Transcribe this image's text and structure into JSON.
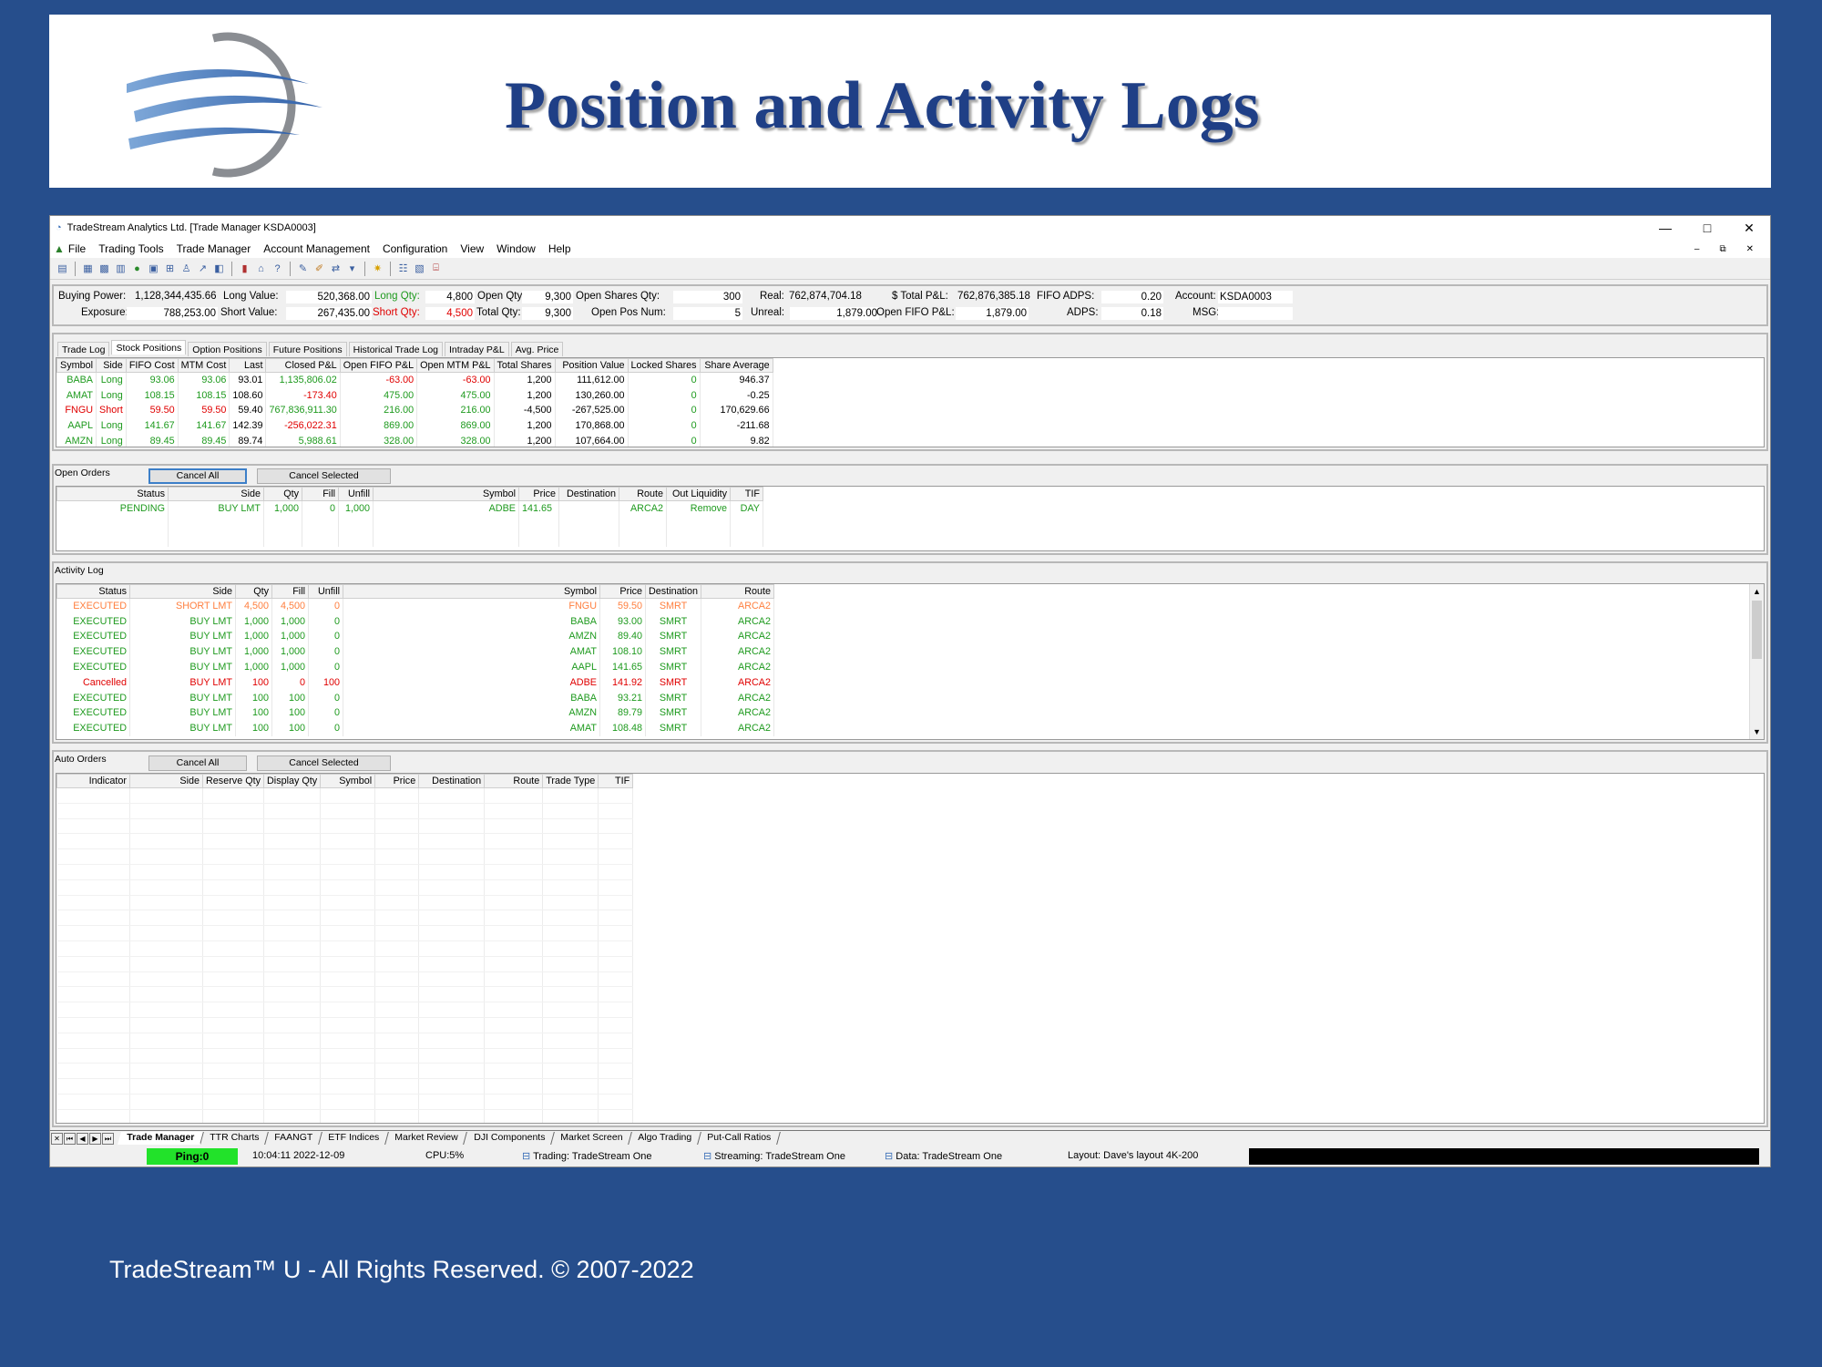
{
  "slide": {
    "title": "Position and Activity Logs",
    "footer": "TradeStream™ U - All Rights Reserved. © 2007-2022",
    "accent": "#1f3f86",
    "background": "#264e8c"
  },
  "window": {
    "title": "TradeStream Analytics Ltd.  [Trade Manager   KSDA0003]",
    "min": "—",
    "max": "□",
    "close": "✕"
  },
  "menu": [
    "File",
    "Trading Tools",
    "Trade Manager",
    "Account Management",
    "Configuration",
    "View",
    "Window",
    "Help"
  ],
  "mdi": {
    "min": "–",
    "restore": "⧉",
    "close": "✕"
  },
  "summary": {
    "buying_power_label": "Buying Power:",
    "buying_power": "1,128,344,435.66",
    "exposure_label": "Exposure:",
    "exposure": "788,253.00",
    "long_value_label": "Long Value:",
    "long_value": "520,368.00",
    "short_value_label": "Short Value:",
    "short_value": "267,435.00",
    "long_qty_label": "Long Qty:",
    "long_qty": "4,800",
    "short_qty_label": "Short Qty:",
    "short_qty": "4,500",
    "open_qty_label": "Open Qty:",
    "open_qty": "9,300",
    "total_qty_label": "Total Qty:",
    "total_qty": "9,300",
    "open_shares_label": "Open Shares Qty:",
    "open_shares": "300",
    "open_pos_label": "Open Pos Num:",
    "open_pos": "5",
    "real_label": "Real:",
    "real": "762,874,704.18",
    "unreal_label": "Unreal:",
    "unreal": "1,879.00",
    "total_pl_label": "$ Total P&L:",
    "total_pl": "762,876,385.18",
    "open_fifo_label": "Open FIFO P&L:",
    "open_fifo": "1,879.00",
    "fifo_adps_label": "FIFO ADPS:",
    "fifo_adps": "0.20",
    "adps_label": "ADPS:",
    "adps": "0.18",
    "account_label": "Account:",
    "account": "KSDA0003",
    "msg_label": "MSG:"
  },
  "tabs": [
    "Trade Log",
    "Stock Positions",
    "Option Positions",
    "Future Positions",
    "Historical Trade Log",
    "Intraday P&L",
    "Avg. Price"
  ],
  "positions": {
    "headers": [
      "Symbol",
      "Side",
      "FIFO Cost",
      "MTM Cost",
      "Last",
      "Closed P&L",
      "Open FIFO P&L",
      "Open MTM P&L",
      "Total Shares",
      "Position Value",
      "Locked Shares",
      "Share Average"
    ],
    "rows": [
      {
        "c": "g",
        "v": [
          "BABA",
          "Long",
          "93.06",
          "93.06",
          "93.01",
          "1,135,806.02",
          "-63.00",
          "-63.00",
          "1,200",
          "111,612.00",
          "0",
          "946.37"
        ],
        "pl": [
          "g",
          "r",
          "r"
        ]
      },
      {
        "c": "g",
        "v": [
          "AMAT",
          "Long",
          "108.15",
          "108.15",
          "108.60",
          "-173.40",
          "475.00",
          "475.00",
          "1,200",
          "130,260.00",
          "0",
          "-0.25"
        ],
        "pl": [
          "r",
          "g",
          "g"
        ]
      },
      {
        "c": "r",
        "v": [
          "FNGU",
          "Short",
          "59.50",
          "59.50",
          "59.40",
          "767,836,911.30",
          "216.00",
          "216.00",
          "-4,500",
          "-267,525.00",
          "0",
          "170,629.66"
        ],
        "pl": [
          "g",
          "g",
          "g"
        ]
      },
      {
        "c": "g",
        "v": [
          "AAPL",
          "Long",
          "141.67",
          "141.67",
          "142.39",
          "-256,022.31",
          "869.00",
          "869.00",
          "1,200",
          "170,868.00",
          "0",
          "-211.68"
        ],
        "pl": [
          "r",
          "g",
          "g"
        ]
      },
      {
        "c": "g",
        "v": [
          "AMZN",
          "Long",
          "89.45",
          "89.45",
          "89.74",
          "5,988.61",
          "328.00",
          "328.00",
          "1,200",
          "107,664.00",
          "0",
          "9.82"
        ],
        "pl": [
          "g",
          "g",
          "g"
        ]
      }
    ]
  },
  "open_orders": {
    "label": "Open Orders",
    "cancel_all": "Cancel All",
    "cancel_selected": "Cancel Selected",
    "headers": [
      "Status",
      "Side",
      "Qty",
      "Fill",
      "Unfill",
      "Symbol",
      "Price",
      "Destination",
      "Route",
      "Out Liquidity",
      "TIF"
    ],
    "rows": [
      [
        "PENDING",
        "BUY  LMT",
        "1,000",
        "0",
        "1,000",
        "ADBE",
        "141.65",
        "",
        "ARCA2",
        "Remove",
        "DAY"
      ]
    ]
  },
  "activity_log": {
    "label": "Activity Log",
    "headers": [
      "Status",
      "Side",
      "Qty",
      "Fill",
      "Unfill",
      "Symbol",
      "Price",
      "Destination",
      "Route"
    ],
    "rows": [
      {
        "c": "o",
        "v": [
          "EXECUTED",
          "SHORT  LMT",
          "4,500",
          "4,500",
          "0",
          "FNGU",
          "59.50",
          "SMRT",
          "ARCA2"
        ]
      },
      {
        "c": "g",
        "v": [
          "EXECUTED",
          "BUY  LMT",
          "1,000",
          "1,000",
          "0",
          "BABA",
          "93.00",
          "SMRT",
          "ARCA2"
        ]
      },
      {
        "c": "g",
        "v": [
          "EXECUTED",
          "BUY  LMT",
          "1,000",
          "1,000",
          "0",
          "AMZN",
          "89.40",
          "SMRT",
          "ARCA2"
        ]
      },
      {
        "c": "g",
        "v": [
          "EXECUTED",
          "BUY  LMT",
          "1,000",
          "1,000",
          "0",
          "AMAT",
          "108.10",
          "SMRT",
          "ARCA2"
        ]
      },
      {
        "c": "g",
        "v": [
          "EXECUTED",
          "BUY  LMT",
          "1,000",
          "1,000",
          "0",
          "AAPL",
          "141.65",
          "SMRT",
          "ARCA2"
        ]
      },
      {
        "c": "r",
        "v": [
          "Cancelled",
          "BUY  LMT",
          "100",
          "0",
          "100",
          "ADBE",
          "141.92",
          "SMRT",
          "ARCA2"
        ]
      },
      {
        "c": "g",
        "v": [
          "EXECUTED",
          "BUY  LMT",
          "100",
          "100",
          "0",
          "BABA",
          "93.21",
          "SMRT",
          "ARCA2"
        ]
      },
      {
        "c": "g",
        "v": [
          "EXECUTED",
          "BUY  LMT",
          "100",
          "100",
          "0",
          "AMZN",
          "89.79",
          "SMRT",
          "ARCA2"
        ]
      },
      {
        "c": "g",
        "v": [
          "EXECUTED",
          "BUY  LMT",
          "100",
          "100",
          "0",
          "AMAT",
          "108.48",
          "SMRT",
          "ARCA2"
        ]
      }
    ]
  },
  "auto_orders": {
    "label": "Auto Orders",
    "cancel_all": "Cancel All",
    "cancel_selected": "Cancel Selected",
    "headers": [
      "Indicator",
      "Side",
      "Reserve Qty",
      "Display Qty",
      "Symbol",
      "Price",
      "Destination",
      "Route",
      "Trade Type",
      "TIF"
    ]
  },
  "sheet_tabs": [
    "Trade Manager",
    "TTR Charts",
    "FAANGT",
    "ETF Indices",
    "Market Review",
    "DJI Components",
    "Market Screen",
    "Algo Trading",
    "Put-Call Ratios"
  ],
  "status": {
    "ping": "Ping:0",
    "time": "10:04:11 2022-12-09",
    "cpu": "CPU:5%",
    "trading": "Trading: TradeStream One",
    "streaming": "Streaming: TradeStream One",
    "data": "Data: TradeStream One",
    "layout": "Layout: Dave's layout 4K-200"
  }
}
